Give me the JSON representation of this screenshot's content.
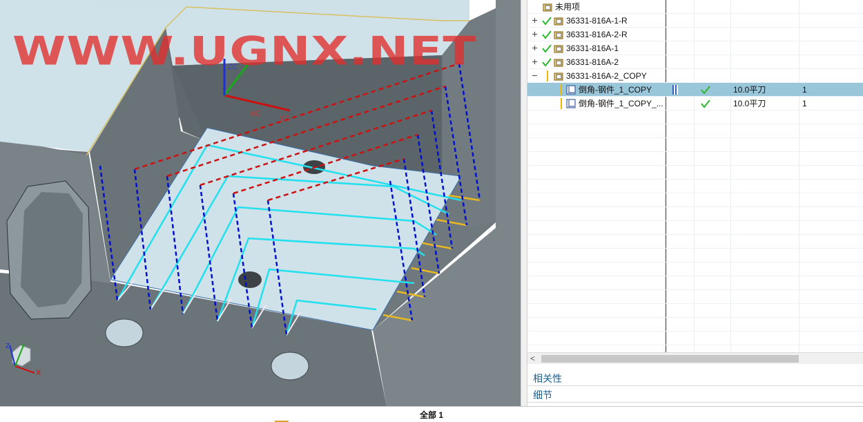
{
  "watermark": "WWW.UGNX.NET",
  "viewport": {
    "csys_labels": {
      "xc": "XC",
      "yc": "YC",
      "zc": "ZC"
    },
    "triad_labels": {
      "x": "X",
      "y": "Y",
      "z": "Z"
    }
  },
  "tree": {
    "rows": [
      {
        "name": "未用项",
        "check": false,
        "expandable": false,
        "tool": "",
        "count": ""
      },
      {
        "name": "36331-816A-1-R",
        "check": true,
        "expandable": true,
        "tool": "",
        "count": ""
      },
      {
        "name": "36331-816A-2-R",
        "check": true,
        "expandable": true,
        "tool": "",
        "count": ""
      },
      {
        "name": "36331-816A-1",
        "check": true,
        "expandable": true,
        "tool": "",
        "count": ""
      },
      {
        "name": "36331-816A-2",
        "check": true,
        "expandable": true,
        "tool": "",
        "count": ""
      },
      {
        "name": "36331-816A-2_COPY",
        "check": false,
        "expandable": true,
        "tool": "",
        "count": ""
      },
      {
        "name": "倒角-钢件_1_COPY",
        "check": true,
        "selected": true,
        "tool": "10.0平刀",
        "count": "1"
      },
      {
        "name": "倒角-钢件_1_COPY_...",
        "check": true,
        "selected": false,
        "tool": "10.0平刀",
        "count": "1"
      }
    ]
  },
  "panels": {
    "dependencies": "相关性",
    "details": "细节"
  },
  "status": {
    "text": "全部 1"
  },
  "colors": {
    "selection": "#99c6d9",
    "check": "#2db82d",
    "panel_text": "#1b5f8f",
    "toolpath_cut": "#22e0ee",
    "toolpath_rapid": "#cc1111",
    "toolpath_feed": "#0000cc",
    "watermark": "#e12d2d"
  }
}
